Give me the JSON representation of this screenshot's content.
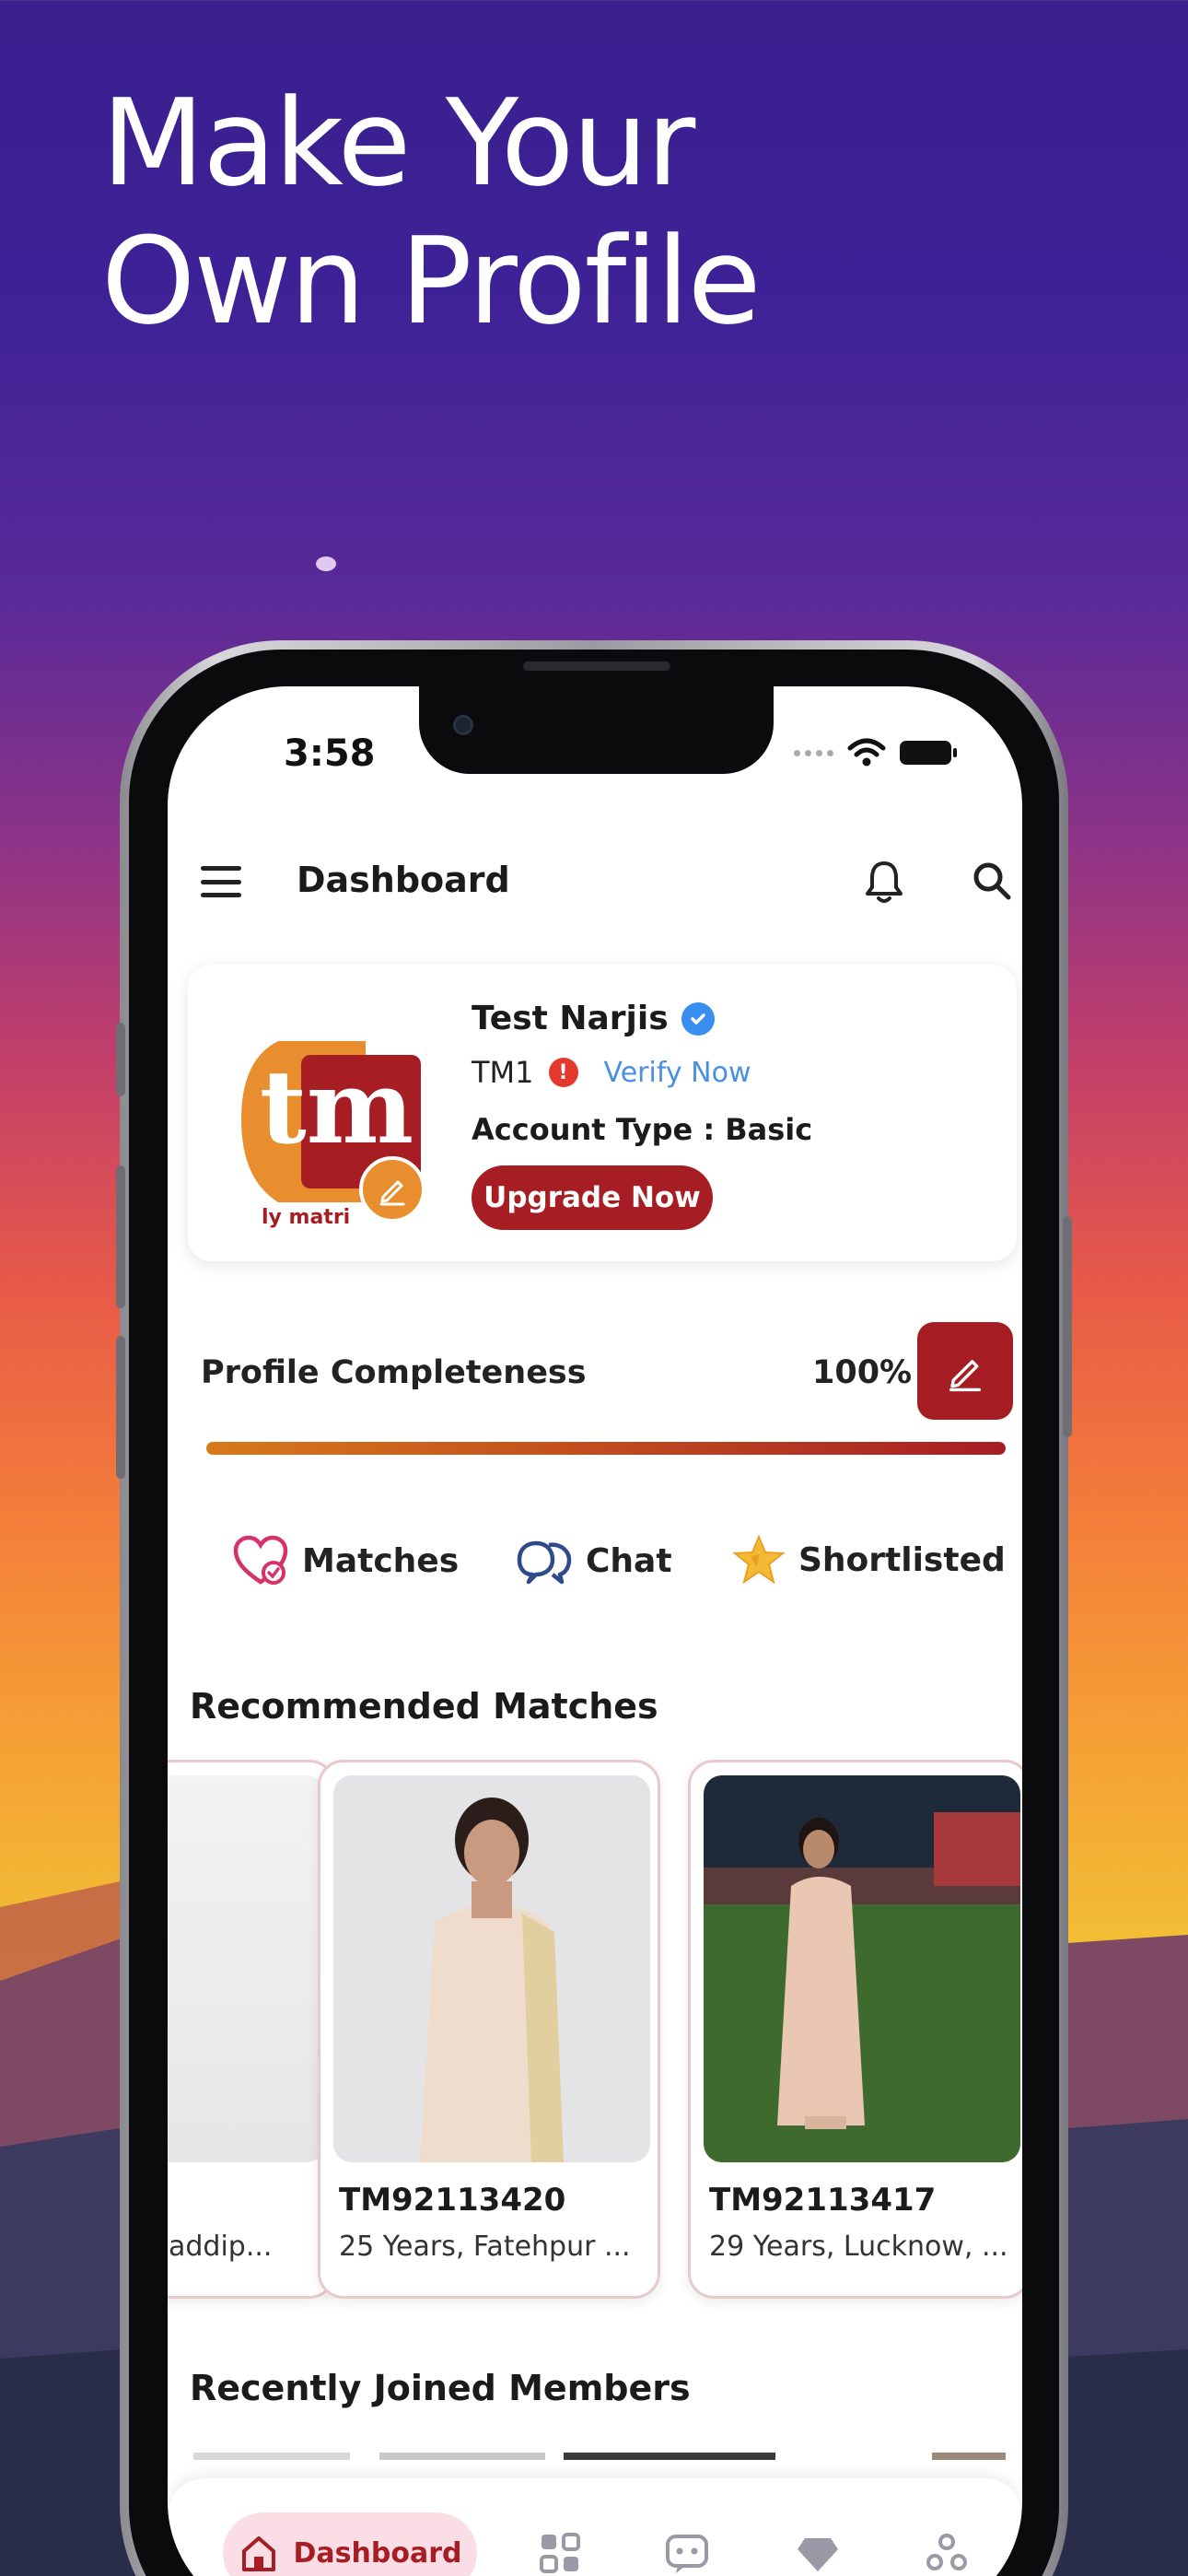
{
  "headline": {
    "line1": "Make Your",
    "line2": "Own Profile"
  },
  "status_bar": {
    "time": "3:58"
  },
  "app_bar": {
    "title": "Dashboard"
  },
  "profile": {
    "name": "Test Narjis",
    "id": "TM1",
    "verify_link": "Verify Now",
    "account_type": "Account Type : Basic",
    "upgrade_label": "Upgrade Now",
    "logo_text": "tm",
    "logo_caption": "ly matri"
  },
  "profile_completeness": {
    "label": "Profile Completeness",
    "percent_text": "100%",
    "percent": 100
  },
  "quick_actions": [
    {
      "label": "Matches",
      "icon": "heart-check-icon"
    },
    {
      "label": "Chat",
      "icon": "chat-bubbles-icon"
    },
    {
      "label": "Shortlisted",
      "icon": "star-icon"
    }
  ],
  "recommended": {
    "title": "Recommended Matches",
    "cards": [
      {
        "id": "",
        "desc": "addip..."
      },
      {
        "id": "TM92113420",
        "desc": "25 Years, Fatehpur ..."
      },
      {
        "id": "TM92113417",
        "desc": "29 Years, Lucknow, ..."
      }
    ]
  },
  "recent": {
    "title": "Recently Joined Members"
  },
  "bottom_nav": {
    "active_label": "Dashboard",
    "items": [
      "home-icon",
      "grid-icon",
      "message-icon",
      "diamond-icon",
      "more-icon"
    ]
  },
  "colors": {
    "brand": "#a61e24",
    "accent": "#e88e2e",
    "link": "#4a90e2",
    "nav_active_bg": "#fbdde5"
  }
}
